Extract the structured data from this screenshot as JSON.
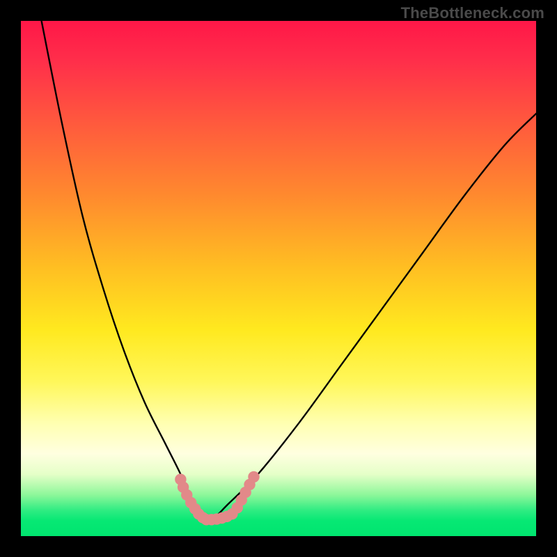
{
  "watermark": {
    "text": "TheBottleneck.com"
  },
  "gradient": {
    "stops": [
      {
        "pos": 0,
        "color": "#ff1748"
      },
      {
        "pos": 8,
        "color": "#ff2f4a"
      },
      {
        "pos": 20,
        "color": "#ff5a3d"
      },
      {
        "pos": 34,
        "color": "#ff8a2e"
      },
      {
        "pos": 48,
        "color": "#ffbf22"
      },
      {
        "pos": 60,
        "color": "#ffe91f"
      },
      {
        "pos": 70,
        "color": "#fff75a"
      },
      {
        "pos": 78,
        "color": "#ffffb0"
      },
      {
        "pos": 84,
        "color": "#ffffe0"
      },
      {
        "pos": 88,
        "color": "#e5ffc8"
      },
      {
        "pos": 92,
        "color": "#8df79a"
      },
      {
        "pos": 95,
        "color": "#2fec82"
      },
      {
        "pos": 97,
        "color": "#07e874"
      },
      {
        "pos": 100,
        "color": "#00e56f"
      }
    ]
  },
  "chart_data": {
    "type": "line",
    "title": "",
    "xlabel": "",
    "ylabel": "",
    "xlim": [
      0,
      100
    ],
    "ylim": [
      0,
      100
    ],
    "series": [
      {
        "name": "bottleneck-curve",
        "color": "#000000",
        "x": [
          4,
          8,
          12,
          16,
          20,
          24,
          28,
          31,
          33,
          34.5,
          36,
          38,
          40,
          46,
          54,
          62,
          70,
          78,
          86,
          94,
          100
        ],
        "y": [
          100,
          80,
          62,
          48,
          36,
          26,
          18,
          12,
          7,
          4,
          3,
          4,
          6,
          12,
          22,
          33,
          44,
          55,
          66,
          76,
          82
        ]
      }
    ],
    "highlight": {
      "name": "highlighted-range",
      "color": "#e28989",
      "points": [
        {
          "x": 31.0,
          "y": 11.0
        },
        {
          "x": 31.5,
          "y": 9.5
        },
        {
          "x": 32.2,
          "y": 8.0
        },
        {
          "x": 33.0,
          "y": 6.5
        },
        {
          "x": 33.8,
          "y": 5.3
        },
        {
          "x": 34.5,
          "y": 4.3
        },
        {
          "x": 35.3,
          "y": 3.6
        },
        {
          "x": 36.0,
          "y": 3.2
        },
        {
          "x": 37.0,
          "y": 3.2
        },
        {
          "x": 38.0,
          "y": 3.3
        },
        {
          "x": 39.0,
          "y": 3.5
        },
        {
          "x": 40.0,
          "y": 3.8
        },
        {
          "x": 41.0,
          "y": 4.3
        },
        {
          "x": 42.0,
          "y": 5.5
        },
        {
          "x": 42.8,
          "y": 7.0
        },
        {
          "x": 43.6,
          "y": 8.5
        },
        {
          "x": 44.4,
          "y": 10.0
        },
        {
          "x": 45.2,
          "y": 11.5
        }
      ]
    },
    "min_point": {
      "x": 36,
      "y": 3
    }
  }
}
